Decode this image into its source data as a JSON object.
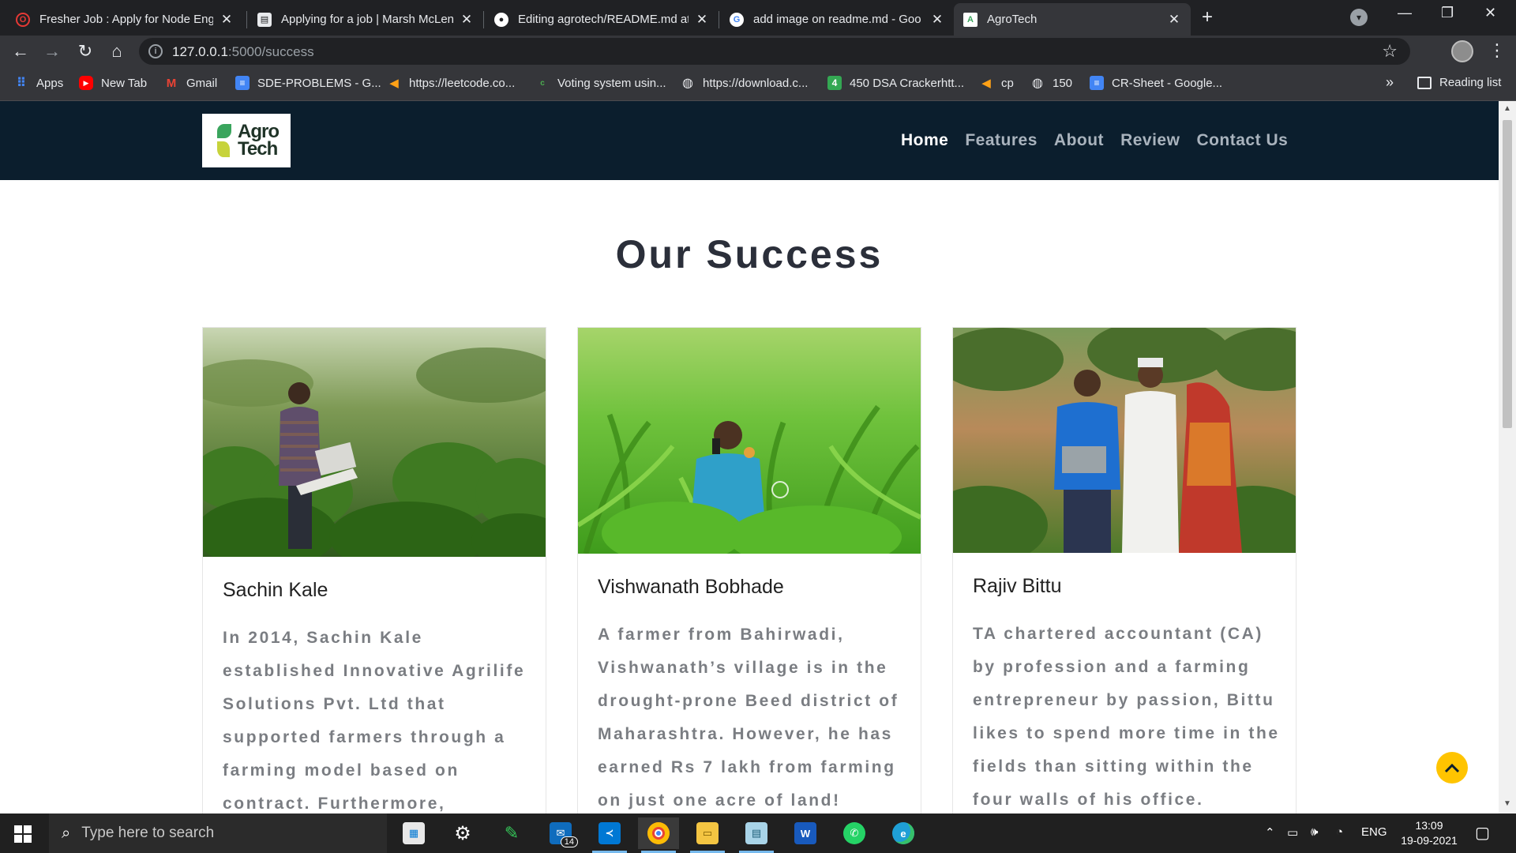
{
  "browser": {
    "tabs": [
      {
        "title": "Fresher Job : Apply for Node Eng",
        "icon": "opera-icon",
        "color": "#e53935"
      },
      {
        "title": "Applying for a job | Marsh McLen",
        "icon": "document-icon",
        "color": "#e8eaed"
      },
      {
        "title": "Editing agrotech/README.md at",
        "icon": "github-icon",
        "color": "#ffffff"
      },
      {
        "title": "add image on readme.md - Goo",
        "icon": "google-icon",
        "color": "#4285f4"
      },
      {
        "title": "AgroTech",
        "icon": "agrotech-favicon",
        "color": "#3aa55d"
      }
    ],
    "url_host": "127.0.0.1",
    "url_path": ":5000/success",
    "bookmarks": [
      {
        "label": "Apps",
        "icon": "apps-grid-icon",
        "color": "#ea4335"
      },
      {
        "label": "New Tab",
        "icon": "youtube-icon",
        "color": "#ff0000"
      },
      {
        "label": "Gmail",
        "icon": "gmail-icon",
        "color": "#ea4335"
      },
      {
        "label": "SDE-PROBLEMS - G...",
        "icon": "google-docs-icon",
        "color": "#4285f4"
      },
      {
        "label": "https://leetcode.co...",
        "icon": "leetcode-icon",
        "color": "#ffa116"
      },
      {
        "label": "Voting system usin...",
        "icon": "site-icon",
        "color": "#4caf50"
      },
      {
        "label": "https://download.c...",
        "icon": "globe-icon",
        "color": "#e8eaed"
      },
      {
        "label": "450 DSA Crackerhtt...",
        "icon": "sheet-icon",
        "color": "#34a853"
      },
      {
        "label": "cp",
        "icon": "leetcode-icon",
        "color": "#ffa116"
      },
      {
        "label": "150",
        "icon": "globe-icon",
        "color": "#e8eaed"
      },
      {
        "label": "CR-Sheet - Google...",
        "icon": "google-docs-icon",
        "color": "#4285f4"
      }
    ],
    "more_label": "»",
    "reading_list": "Reading list"
  },
  "site": {
    "logo_line1": "Agro",
    "logo_line2": "Tech",
    "nav": [
      "Home",
      "Features",
      "About",
      "Review",
      "Contact Us"
    ],
    "active_nav": "Home",
    "section_title": "Our Success",
    "cards": [
      {
        "name": "Sachin Kale",
        "description": "In 2014, Sachin Kale established Innovative Agrilife Solutions Pvt. Ltd that supported farmers through a farming model based on contract. Furthermore,"
      },
      {
        "name": "Vishwanath Bobhade",
        "description": "A farmer from Bahirwadi, Vishwanath’s village is in the drought-prone Beed district of Maharashtra. However, he has earned Rs 7 lakh from farming on just one acre of land!"
      },
      {
        "name": "Rajiv Bittu",
        "description": "TA chartered accountant (CA) by profession and a farming entrepreneur by passion, Bittu likes to spend more time in the fields than sitting within the four walls of his office."
      }
    ],
    "accent": "#ffc400",
    "nav_bg": "#0b1e2d"
  },
  "taskbar": {
    "search_placeholder": "Type here to search",
    "mail_badge": "14",
    "lang": "ENG",
    "time": "13:09",
    "date": "19-09-2021",
    "apps": [
      "store-icon",
      "settings-icon",
      "pen-icon",
      "mail-icon",
      "vscode-icon",
      "chrome-icon",
      "file-explorer-icon",
      "notepad-icon",
      "word-icon",
      "whatsapp-icon",
      "edge-icon"
    ]
  }
}
